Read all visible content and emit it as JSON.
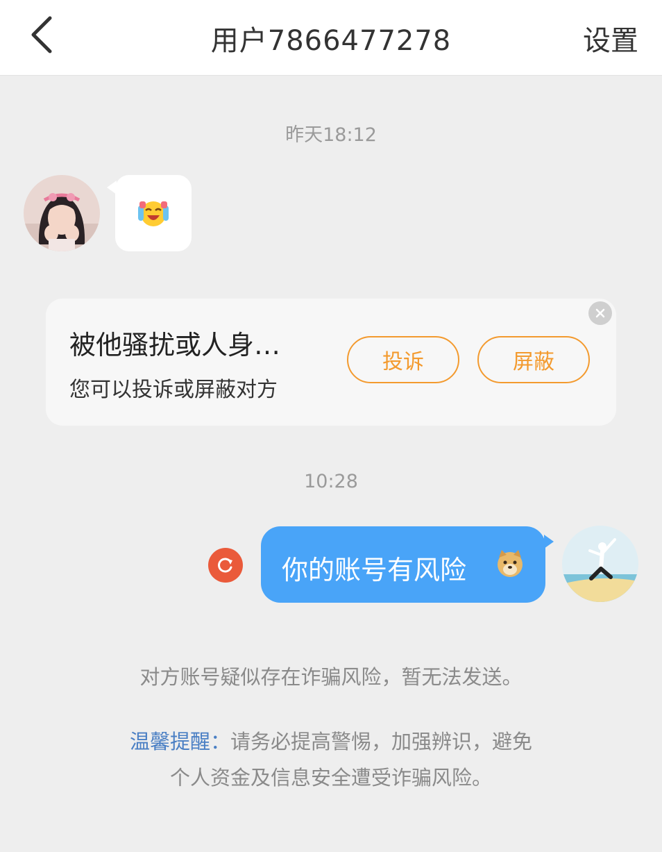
{
  "header": {
    "title": "用户7866477278",
    "settings_label": "设置"
  },
  "chat": {
    "time_1": "昨天18:12",
    "incoming_emoji": "laughing-crying-emoji",
    "time_2": "10:28",
    "outgoing_text": "你的账号有风险",
    "outgoing_emoji": "doge-emoji",
    "send_status": "failed"
  },
  "report_card": {
    "title": "被他骚扰或人身…",
    "subtitle": "您可以投诉或屏蔽对方",
    "report_label": "投诉",
    "block_label": "屏蔽"
  },
  "notice": {
    "blocked_text": "对方账号疑似存在诈骗风险，暂无法发送。",
    "tip_label": "温馨提醒：",
    "tip_line1": "请务必提高警惕，加强辨识，避免",
    "tip_line2": "个人资金及信息安全遭受诈骗风险。"
  },
  "colors": {
    "accent_orange": "#f39a2e",
    "bubble_blue": "#49a4f8",
    "retry_red": "#ea5a3a",
    "tip_blue": "#4a7fc4"
  }
}
